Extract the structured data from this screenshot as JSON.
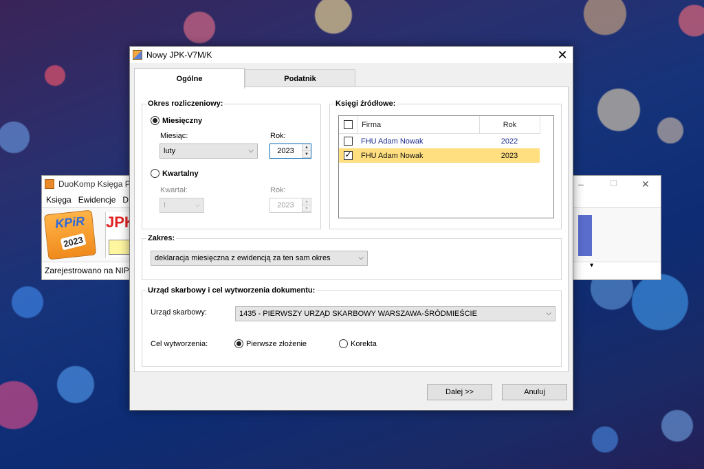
{
  "background_app": {
    "title": "DuoKomp Księga Po",
    "menu": [
      "Księga",
      "Ewidencje",
      "D"
    ],
    "kpir_icon_text": "KPiR",
    "kpir_icon_year": "2023",
    "jpk_icon_text": "JPK",
    "status_text": "Zarejestrowano na NIP",
    "controls": {
      "minimize": "–",
      "maximize": "☐",
      "close": "✕"
    }
  },
  "dialog": {
    "title": "Nowy JPK-V7M/K",
    "close_glyph": "✕",
    "tabs": [
      {
        "label": "Ogólne",
        "active": true
      },
      {
        "label": "Podatnik",
        "active": false
      }
    ],
    "okres": {
      "label": "Okres rozliczeniowy:",
      "monthly": {
        "label": "Miesięczny",
        "checked": true
      },
      "month_label": "Miesiąc:",
      "month_value": "luty",
      "year_label": "Rok:",
      "year_value": "2023",
      "quarterly": {
        "label": "Kwartalny",
        "checked": false
      },
      "quarter_label": "Kwartał:",
      "quarter_value": "I",
      "quarter_year_label": "Rok:",
      "quarter_year_value": "2023"
    },
    "ksiegi": {
      "label": "Księgi źródłowe:",
      "columns": {
        "firma": "Firma",
        "rok": "Rok"
      },
      "header_checked": false,
      "rows": [
        {
          "firma": "FHU Adam Nowak",
          "rok": "2022",
          "checked": false,
          "selected": false
        },
        {
          "firma": "FHU Adam Nowak",
          "rok": "2023",
          "checked": true,
          "selected": true
        }
      ]
    },
    "zakres": {
      "label": "Zakres:",
      "value": "deklaracja miesięczna z ewidencją za ten sam okres"
    },
    "urzad": {
      "label": "Urząd skarbowy i cel wytworzenia dokumentu:",
      "office_label": "Urząd skarbowy:",
      "office_value": "1435 - PIERWSZY URZĄD SKARBOWY WARSZAWA-ŚRÓDMIEŚCIE",
      "cel_label": "Cel wytworzenia:",
      "cel_options": [
        {
          "label": "Pierwsze złożenie",
          "checked": true
        },
        {
          "label": "Korekta",
          "checked": false
        }
      ]
    },
    "buttons": {
      "next": "Dalej >>",
      "cancel": "Anuluj"
    },
    "colors": {
      "selected_row": "#ffdf80",
      "link_text": "#1a2a8a",
      "focus_border": "#0063b1"
    }
  }
}
